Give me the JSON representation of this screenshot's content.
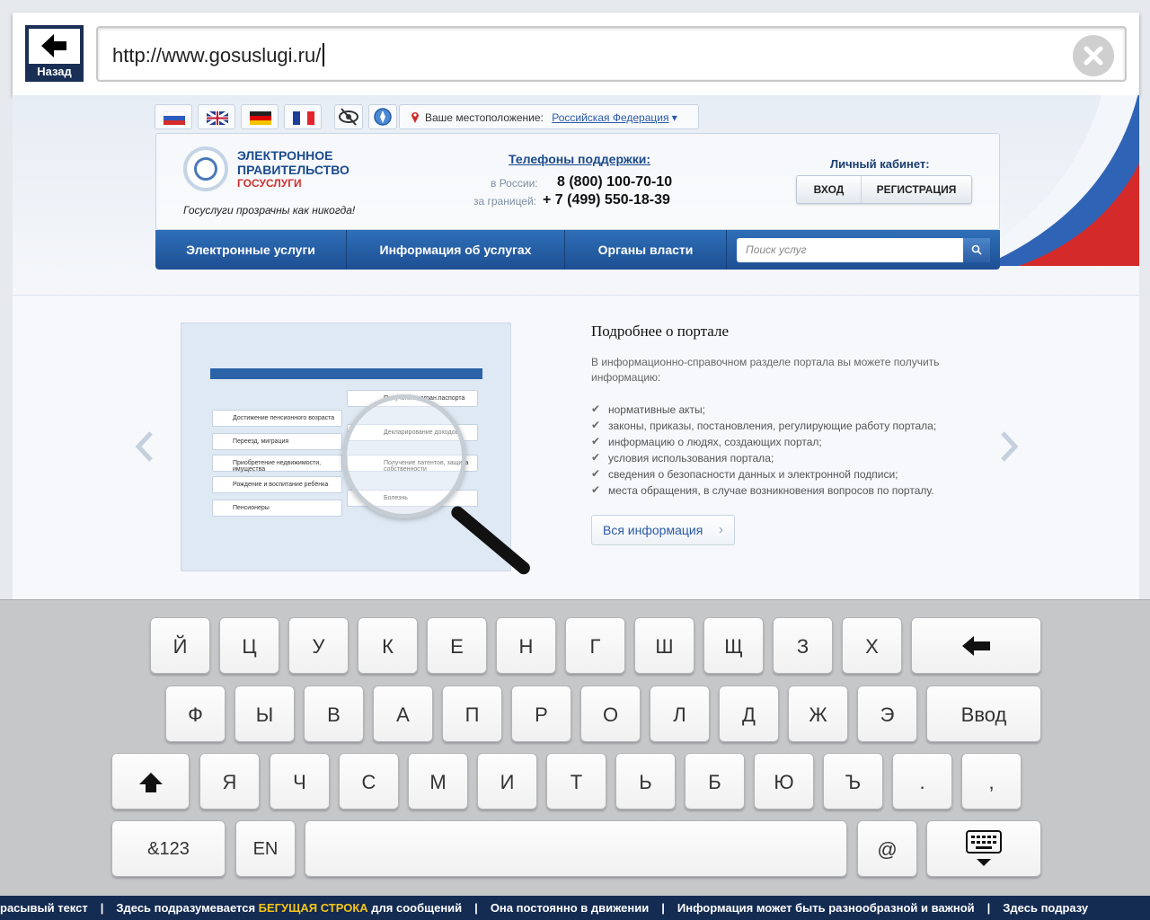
{
  "toolbar": {
    "back_label": "Назад",
    "url": "http://www.gosuslugi.ru/"
  },
  "site": {
    "location_label": "Ваше местоположение:",
    "location_value": "Российская Федерация",
    "logo_line1": "ЭЛЕКТРОННОЕ",
    "logo_line2": "ПРАВИТЕЛЬСТВО",
    "logo_line3": "ГОСУСЛУГИ",
    "slogan": "Госуслуги прозрачны как никогда!",
    "phones_title": "Телефоны поддержки:",
    "phone_ru_label": "в России:",
    "phone_ru": "8 (800) 100-70-10",
    "phone_abroad_label": "за границей:",
    "phone_abroad": "+ 7 (499) 550-18-39",
    "cabinet_title": "Личный кабинет:",
    "login_label": "ВХОД",
    "register_label": "РЕГИСТРАЦИЯ",
    "nav": [
      {
        "label": "Электронные услуги"
      },
      {
        "label": "Информация об услугах"
      },
      {
        "label": "Органы власти"
      }
    ],
    "search_placeholder": "Поиск услуг"
  },
  "about": {
    "title": "Подробнее о портале",
    "intro": "В информационно-справочном разделе портала вы можете получить информацию:",
    "items": [
      "нормативные акты;",
      "законы, приказы, постановления, регулирующие работу портала;",
      "информацию о людях, создающих портал;",
      "условия использования портала;",
      "сведения о безопасности данных и электронной подписи;",
      "места обращения, в случае возникновения вопросов по порталу."
    ],
    "button_label": "Вся информация"
  },
  "preview": {
    "rows_left": [
      "Достижение пенсионного возраста",
      "Переезд, миграция",
      "Приобретение недвижимости, имущества",
      "Рождение и воспитание ребёнка",
      "Пенсионеры"
    ],
    "rows_right": [
      "Получение загран.паспорта",
      "Декларирование доходов",
      "Получение патентов, защита собственности",
      "",
      "Болезнь"
    ]
  },
  "keyboard": {
    "row1": [
      "Й",
      "Ц",
      "У",
      "К",
      "Е",
      "Н",
      "Г",
      "Ш",
      "Щ",
      "З",
      "Х"
    ],
    "row2": [
      "Ф",
      "Ы",
      "В",
      "А",
      "П",
      "Р",
      "О",
      "Л",
      "Д",
      "Ж",
      "Э"
    ],
    "enter_label": "Ввод",
    "row3": [
      "Я",
      "Ч",
      "С",
      "М",
      "И",
      "Т",
      "Ь",
      "Б",
      "Ю",
      "Ъ",
      ".",
      ","
    ],
    "num_label": "&123",
    "lang_label": "EN",
    "at_label": "@"
  },
  "ticker": {
    "parts": [
      "расывый текст",
      "Здесь подразумевается ",
      "БЕГУЩАЯ СТРОКА",
      " для сообщений",
      "Она постоянно в движении",
      "Информация может быть разнообразной и важной",
      "Здесь подразу"
    ]
  },
  "colors": {
    "brand_blue": "#1d4f93",
    "ticker_bg": "#142b52",
    "ticker_highlight": "#f5c518"
  }
}
